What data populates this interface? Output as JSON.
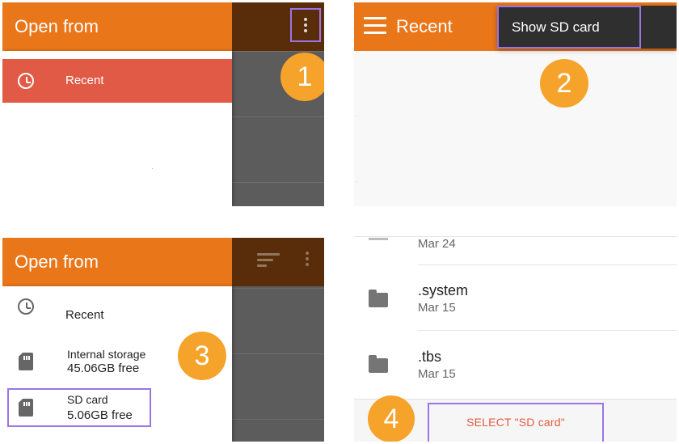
{
  "panel_1": {
    "title": "Open from",
    "drawer": {
      "items": [
        {
          "label": "Recent",
          "icon": "clock-icon",
          "selected": true
        }
      ]
    },
    "highlight": {
      "target": "overflow-menu-button"
    },
    "step": "1"
  },
  "panel_2": {
    "title": "Recent",
    "menu": {
      "item_label": "Show SD card"
    },
    "step": "2"
  },
  "panel_3": {
    "title": "Open from",
    "drawer": {
      "items": [
        {
          "label": "Recent",
          "icon": "clock-icon"
        },
        {
          "label": "Internal storage",
          "detail": "45.06GB free",
          "icon": "sd-card-icon"
        },
        {
          "label": "SD card",
          "detail": "5.06GB free",
          "icon": "sd-card-icon",
          "highlighted": true
        }
      ]
    },
    "step": "3"
  },
  "panel_4": {
    "files": [
      {
        "name": "",
        "date": "Mar 24",
        "icon": "folder-icon"
      },
      {
        "name": ".system",
        "date": "Mar 15",
        "icon": "folder-icon"
      },
      {
        "name": ".tbs",
        "date": "Mar 15",
        "icon": "folder-icon"
      }
    ],
    "action_label": "SELECT \"SD card\"",
    "step": "4"
  },
  "colors": {
    "orange": "#ea761a",
    "drawer_selected": "#e15a45",
    "step_badge": "#f5a32b",
    "highlight_purple": "#9b74e6",
    "dark_popup": "#2f2f2f"
  }
}
